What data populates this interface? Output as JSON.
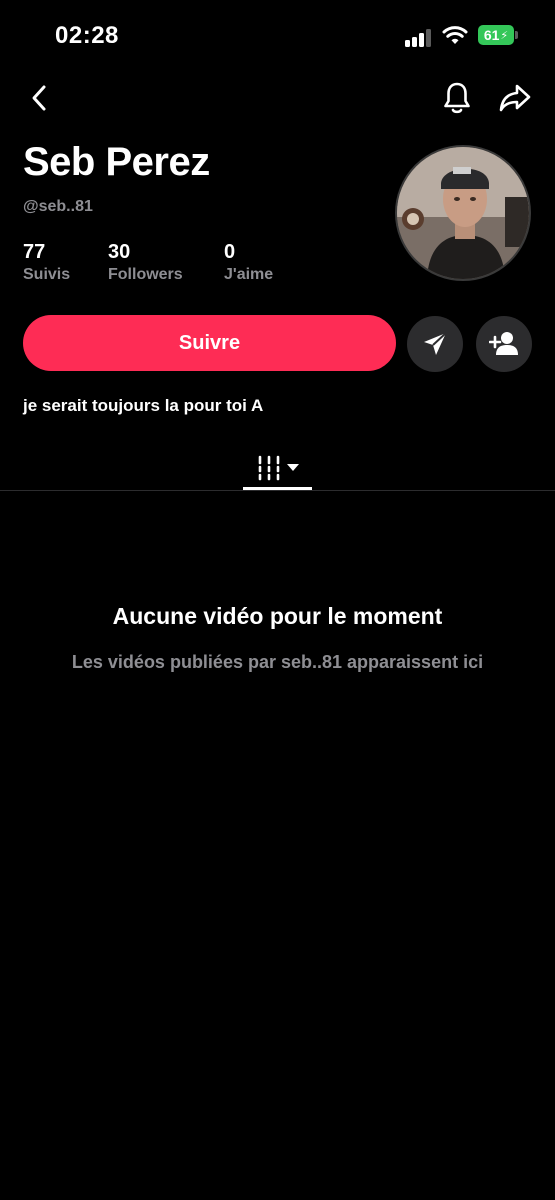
{
  "status_bar": {
    "time": "02:28",
    "battery": "61"
  },
  "icons": {
    "back": "chevron-left-icon",
    "notifications": "bell-icon",
    "share": "share-arrow-icon",
    "message": "send-icon",
    "add_friend": "person-add-icon",
    "videos_tab": "grid-bars-icon",
    "dropdown": "caret-down-icon"
  },
  "profile": {
    "display_name": "Seb Perez",
    "handle": "@seb..81",
    "stats": [
      {
        "value": "77",
        "label": "Suivis"
      },
      {
        "value": "30",
        "label": "Followers"
      },
      {
        "value": "0",
        "label": "J'aime"
      }
    ],
    "bio": "je serait toujours la pour toi A"
  },
  "actions": {
    "follow_label": "Suivre"
  },
  "empty_state": {
    "title": "Aucune vidéo pour le moment",
    "subtitle": "Les vidéos publiées par seb..81 apparaissent ici"
  },
  "colors": {
    "accent": "#fe2c55",
    "background": "#000000",
    "secondary_text": "#8e8e93",
    "battery": "#34c759"
  }
}
